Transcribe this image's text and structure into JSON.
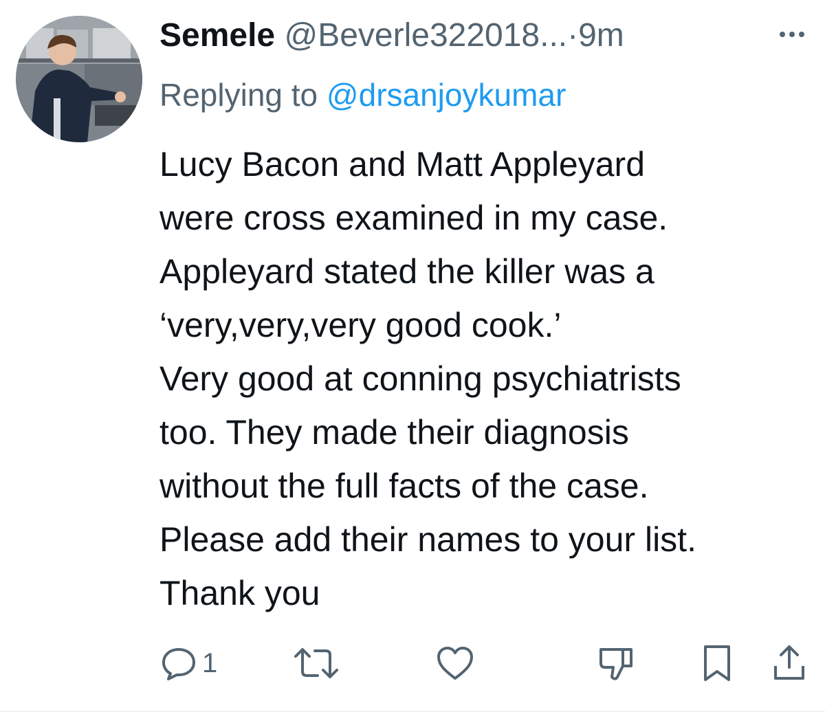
{
  "tweet": {
    "display_name": "Semele",
    "handle": "@Beverle322018...",
    "separator": "·",
    "time": "9m",
    "reply_prefix": "Replying to ",
    "reply_to": "@drsanjoykumar",
    "body_lines": [
      "Lucy Bacon and Matt Appleyard",
      "were cross examined in my case.",
      "Appleyard stated the killer was a",
      "‘very,very,very good cook.’",
      "Very good at conning psychiatrists",
      "too. They made their diagnosis",
      "without the full facts of the case.",
      "Please add their names to your list.",
      "Thank you"
    ]
  },
  "actions": {
    "reply_count": "1",
    "icons": [
      "reply-icon",
      "retweet-icon",
      "like-icon",
      "dislike-icon",
      "bookmark-icon",
      "share-icon"
    ]
  },
  "colors": {
    "text": "#0f1419",
    "secondary": "#536471",
    "link": "#1d9bf0"
  }
}
